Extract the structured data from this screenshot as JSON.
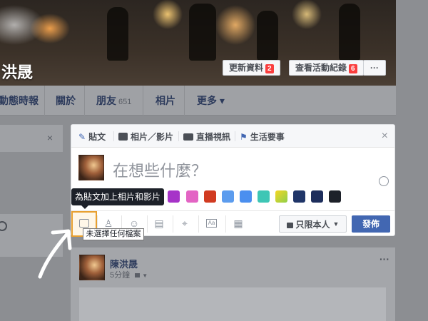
{
  "cover": {
    "name": "洪晟",
    "update_info_label": "更新資料",
    "update_info_badge": "2",
    "activity_log_label": "查看活動紀錄",
    "activity_log_badge": "6",
    "more_label": "···"
  },
  "nav": {
    "items": [
      {
        "label": "動態時報"
      },
      {
        "label": "關於"
      },
      {
        "label": "朋友",
        "count": "651"
      },
      {
        "label": "相片"
      },
      {
        "label": "更多 ▾"
      }
    ]
  },
  "composer": {
    "tabs": [
      {
        "label": "貼文",
        "icon": "pencil-icon"
      },
      {
        "label": "相片／影片",
        "icon": "camera-icon"
      },
      {
        "label": "直播視訊",
        "icon": "video-camera-icon"
      },
      {
        "label": "生活要事",
        "icon": "flag-icon"
      }
    ],
    "close": "×",
    "placeholder": "在想些什麼？",
    "swatch_colors": [
      "#a633c8",
      "#e364c4",
      "#d13b21",
      "#5c9cee",
      "#4b8fef",
      "#3ec6b5",
      "#8fd04a",
      "#1f3568",
      "#1d2e5c",
      "#1d2129"
    ],
    "privacy_label": "只限本人",
    "post_label": "發佈",
    "tooltip_add_photo": "為貼文加上相片和影片",
    "tooltip_no_file": "未選擇任何檔案"
  },
  "post": {
    "author": "陳洪晟",
    "time": "5分鐘",
    "more": "···"
  }
}
